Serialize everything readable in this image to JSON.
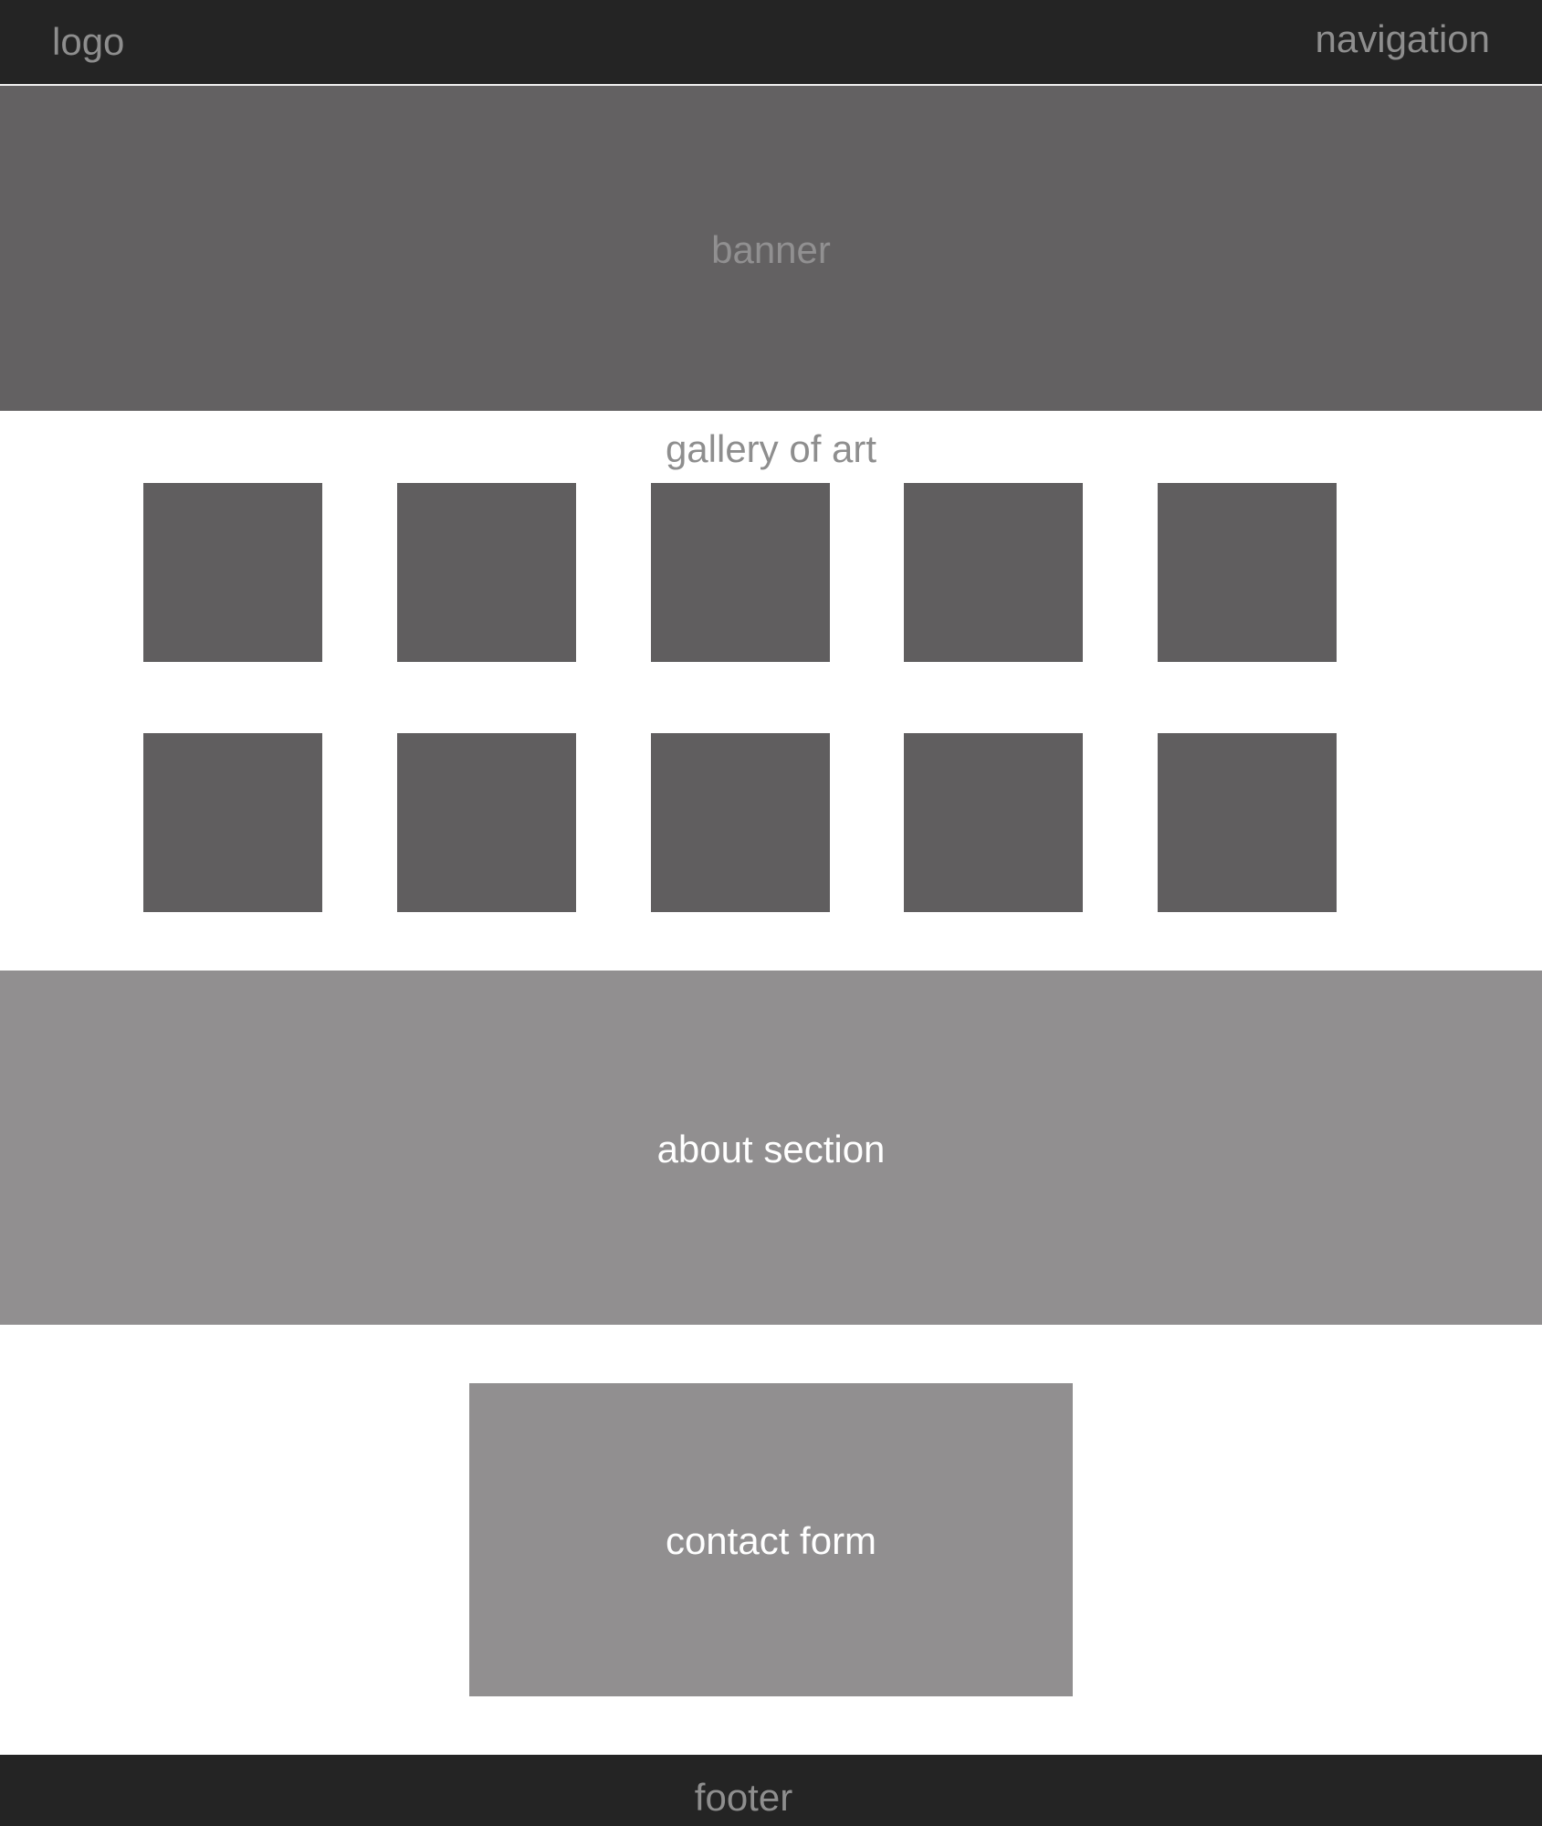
{
  "header": {
    "logo": "logo",
    "navigation": "navigation"
  },
  "banner": {
    "label": "banner"
  },
  "gallery": {
    "title": "gallery of art",
    "items": [
      {
        "name": "gallery-item-1"
      },
      {
        "name": "gallery-item-2"
      },
      {
        "name": "gallery-item-3"
      },
      {
        "name": "gallery-item-4"
      },
      {
        "name": "gallery-item-5"
      },
      {
        "name": "gallery-item-6"
      },
      {
        "name": "gallery-item-7"
      },
      {
        "name": "gallery-item-8"
      },
      {
        "name": "gallery-item-9"
      },
      {
        "name": "gallery-item-10"
      }
    ]
  },
  "about": {
    "label": "about section"
  },
  "contact": {
    "label": "contact form"
  },
  "footer": {
    "label": "footer"
  },
  "colors": {
    "header_bg": "#242424",
    "banner_bg": "#636162",
    "gallery_item_bg": "#605e5f",
    "section_bg": "#918f90",
    "muted_text": "#8e8e8e",
    "light_text": "#ffffff"
  }
}
